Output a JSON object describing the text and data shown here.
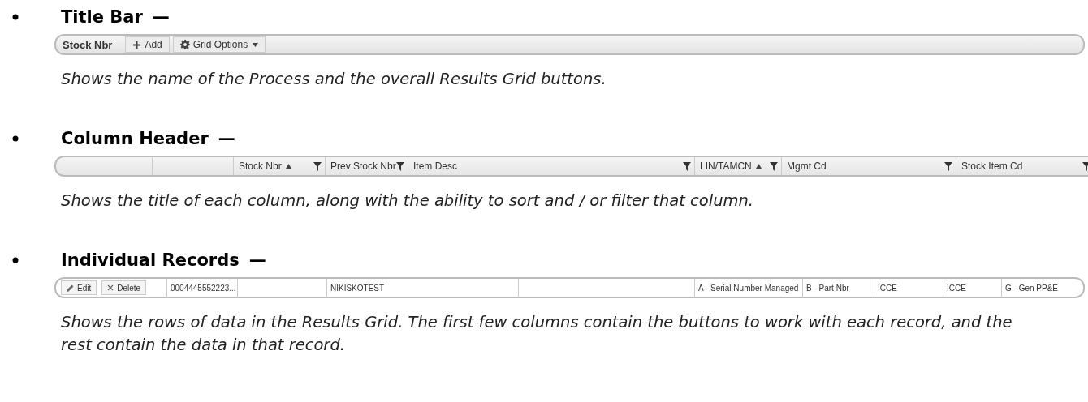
{
  "sections": [
    {
      "kind": "title_bar",
      "heading": "Title Bar",
      "dash": "—",
      "title": "Stock Nbr",
      "buttons": [
        {
          "kind": "add",
          "label": "Add"
        },
        {
          "kind": "options",
          "label": "Grid Options"
        }
      ],
      "description": "Shows the name of the Process and the overall Results Grid buttons."
    },
    {
      "kind": "column_header",
      "heading": "Column Header",
      "dash": "—",
      "columns": [
        {
          "kind": "spacer"
        },
        {
          "kind": "spacer"
        },
        {
          "kind": "column",
          "label": "Stock Nbr",
          "filter": true,
          "sort_ascending": true
        },
        {
          "kind": "column",
          "label": "Prev Stock Nbr",
          "filter": true,
          "sort_ascending": false
        },
        {
          "kind": "column",
          "label": "Item Desc",
          "filter": true,
          "sort_ascending": false
        },
        {
          "kind": "column",
          "label": "LIN/TAMCN",
          "filter": true,
          "sort_ascending": true
        },
        {
          "kind": "column",
          "label": "Mgmt Cd",
          "filter": true,
          "sort_ascending": false
        },
        {
          "kind": "column",
          "label": "Stock Item Cd",
          "filter": true,
          "sort_ascending": false
        }
      ],
      "description": "Shows the title of each column, along with the ability to sort and / or filter that column."
    },
    {
      "kind": "records",
      "heading": "Individual Records",
      "dash": "—",
      "buttons": [
        {
          "kind": "edit",
          "label": "Edit"
        },
        {
          "kind": "delete",
          "label": "Delete"
        }
      ],
      "cells": [
        "0004445552223...",
        null,
        "NIKISKOTEST",
        null,
        "A - Serial Number Managed",
        "B - Part Nbr",
        "ICCE",
        "ICCE",
        "G - Gen PP&E"
      ],
      "description": "Shows the rows of data in the Results Grid. The first few columns contain the buttons to work with each record, and the rest contain the data in that record."
    }
  ]
}
